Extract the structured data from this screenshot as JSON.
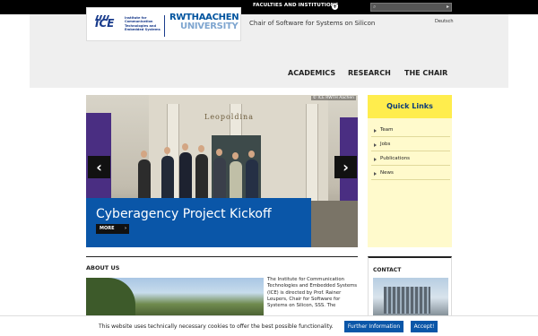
{
  "topbar": {
    "faculties_label": "FACULTIES AND INSTITUTIONS",
    "search_placeholder": ""
  },
  "header": {
    "ice_logo_text": "ICE",
    "ice_full_name": "Institute for Communication Technologies and Embedded Systems",
    "rwth_line1": "RWTHAACHEN",
    "rwth_line2": "UNIVERSITY",
    "chair_title": "Chair of Software for Systems on Silicon",
    "language_link": "Deutsch"
  },
  "nav": {
    "items": [
      {
        "label": "ACADEMICS"
      },
      {
        "label": "RESEARCH"
      },
      {
        "label": "THE CHAIR"
      }
    ]
  },
  "slider": {
    "building_sign": "Leopoldina",
    "photo_credit": "© ICE RWTH Aachen",
    "prev_icon": "chevron-left",
    "next_icon": "chevron-right",
    "caption_title": "Cyberagency Project Kickoff",
    "more_label": "MORE"
  },
  "quick_links": {
    "title": "Quick Links",
    "items": [
      {
        "label": "Team"
      },
      {
        "label": "Jobs"
      },
      {
        "label": "Publications"
      },
      {
        "label": "News"
      }
    ]
  },
  "about": {
    "title": "ABOUT US",
    "text": "The Institute for Communication Technologies and Embedded Systems (ICE) is directed by Prof. Rainer Leupers, Chair for Software for Systems on Silicon, SSS. The"
  },
  "contact": {
    "title": "CONTACT"
  },
  "cookie": {
    "message": "This website uses technically necessary cookies to offer the best possible functionality.",
    "info_button": "Further Information",
    "accept_button": "Accept!"
  },
  "colors": {
    "brand_blue": "#0a56a8",
    "quick_links_yellow": "#ffed4d",
    "quick_links_bg": "#fffacc"
  }
}
